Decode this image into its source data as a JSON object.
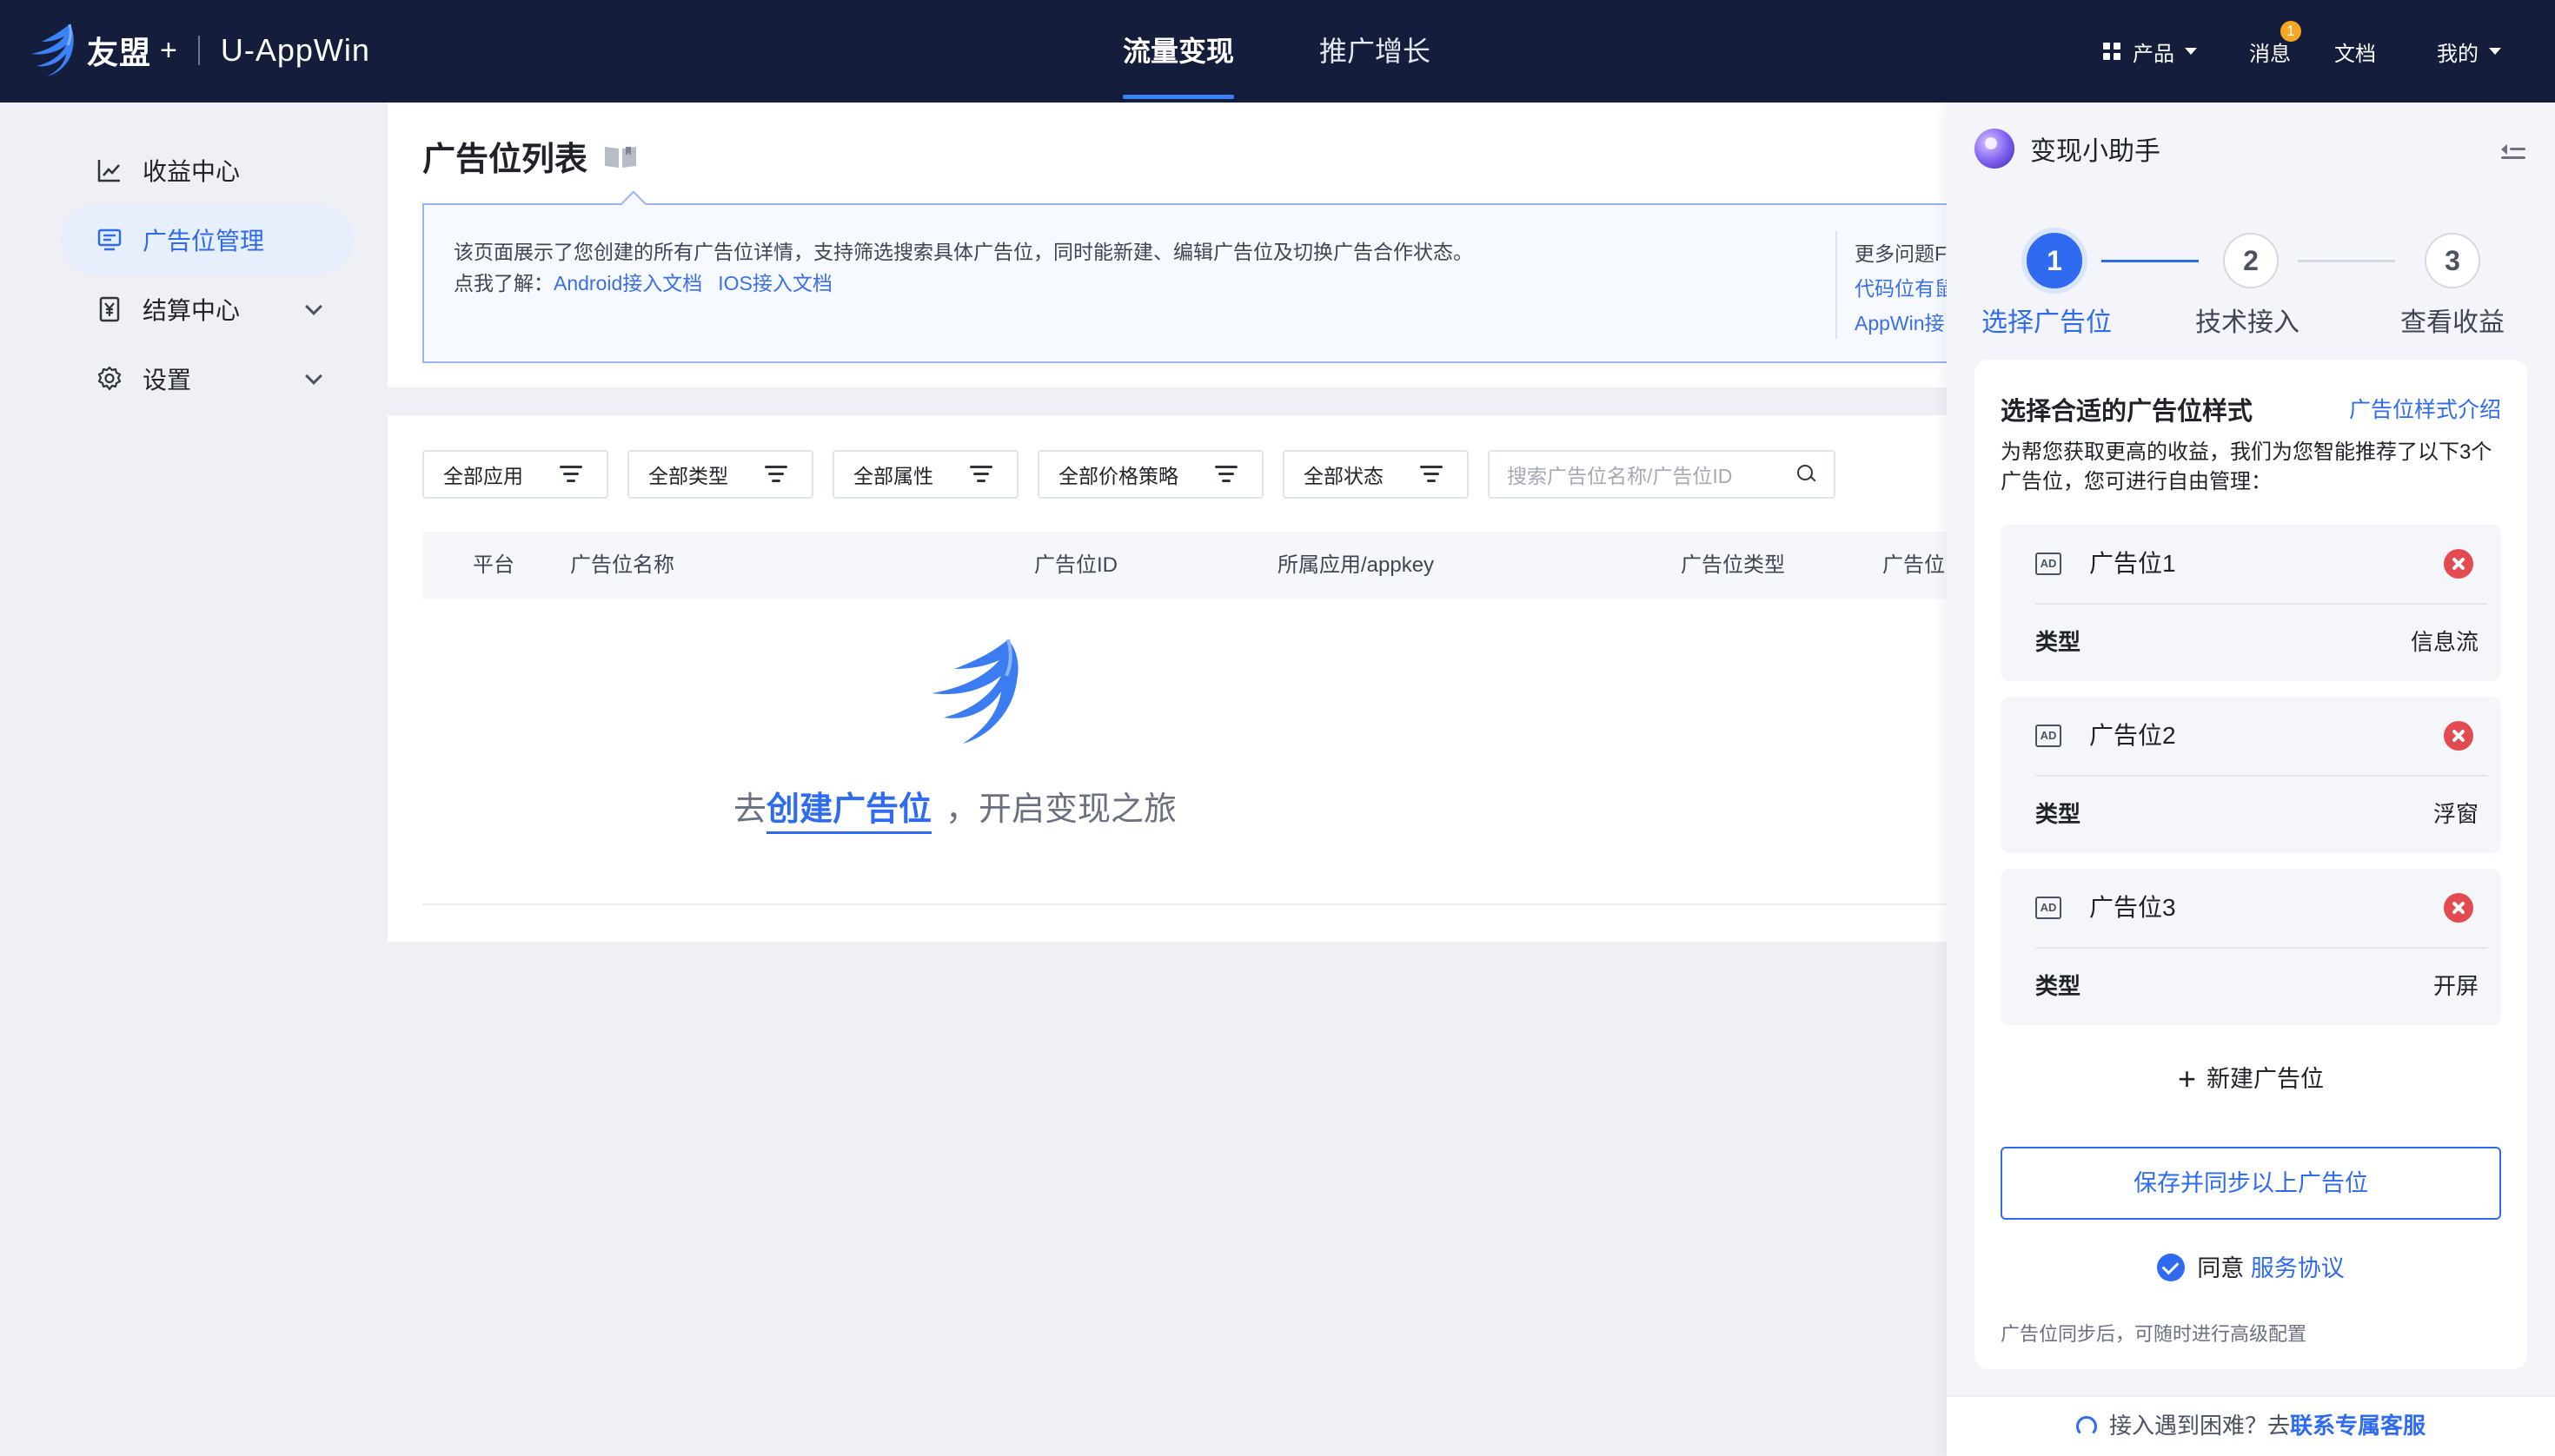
{
  "nav": {
    "brand": "友盟",
    "brand_plus": "+",
    "product": "U-AppWin",
    "tabs": [
      "流量变现",
      "推广增长"
    ],
    "products_label": "产品",
    "messages_label": "消息",
    "messages_badge": "1",
    "docs_label": "文档",
    "me_label": "我的"
  },
  "sidebar": {
    "items": [
      {
        "label": "收益中心",
        "icon": "chart-line-icon"
      },
      {
        "label": "广告位管理",
        "icon": "monitor-icon",
        "active": true
      },
      {
        "label": "结算中心",
        "icon": "yen-receipt-icon"
      },
      {
        "label": "设置",
        "icon": "gear-icon"
      }
    ]
  },
  "page": {
    "title": "广告位列表",
    "notice": {
      "line1": "该页面展示了您创建的所有广告位详情，支持筛选搜索具体广告位，同时能新建、编辑广告位及切换广告合作状态。",
      "line2_prefix": "点我了解：",
      "android_doc": "Android接入文档",
      "ios_doc": "IOS接入文档",
      "more_title": "更多问题F",
      "more_link1": "代码位有鼠",
      "more_link2": "AppWin接"
    },
    "filters": [
      "全部应用",
      "全部类型",
      "全部属性",
      "全部价格策略",
      "全部状态"
    ],
    "search_placeholder": "搜索广告位名称/广告位ID",
    "columns": [
      "平台",
      "广告位名称",
      "广告位ID",
      "所属应用/appkey",
      "广告位类型",
      "广告位"
    ],
    "empty": {
      "prefix": "去",
      "link": "创建广告位",
      "suffix": "，开启变现之旅"
    }
  },
  "assistant": {
    "title": "变现小助手",
    "steps": [
      {
        "num": "1",
        "label": "选择广告位"
      },
      {
        "num": "2",
        "label": "技术接入"
      },
      {
        "num": "3",
        "label": "查看收益"
      }
    ],
    "card_title": "选择合适的广告位样式",
    "card_link": "广告位样式介绍",
    "desc": "为帮您获取更高的收益，我们为您智能推荐了以下3个广告位，您可进行自由管理：",
    "ad_icon_text": "AD",
    "type_key": "类型",
    "ads": [
      {
        "name": "广告位1",
        "type": "信息流"
      },
      {
        "name": "广告位2",
        "type": "浮窗"
      },
      {
        "name": "广告位3",
        "type": "开屏"
      }
    ],
    "add_label": "新建广告位",
    "save_label": "保存并同步以上广告位",
    "agree_prefix": "同意",
    "agree_link": "服务协议",
    "note": "广告位同步后，可随时进行高级配置",
    "footer_prefix": "接入遇到困难？去",
    "footer_link": "联系专属客服"
  },
  "colors": {
    "nav_bg": "#141d3b",
    "accent": "#2f6bf0",
    "danger": "#e34b50",
    "badge": "#f5a623"
  }
}
